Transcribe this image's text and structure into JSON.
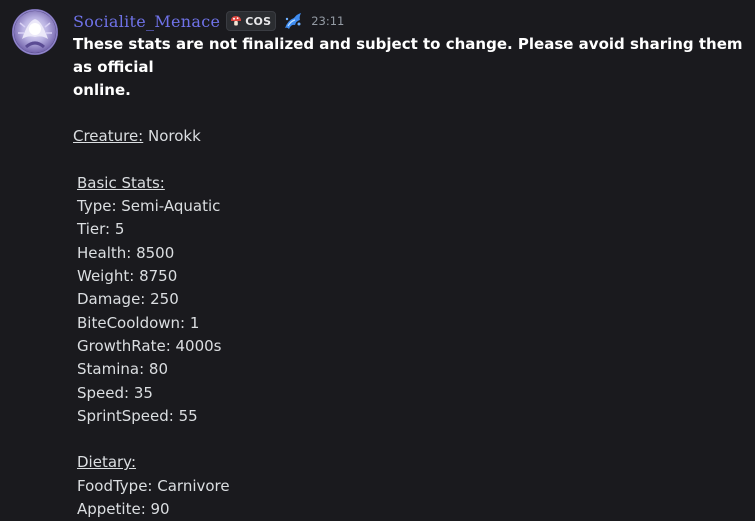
{
  "message": {
    "username": "Socialite_Menace",
    "tag": {
      "text": "COS",
      "icon": "mushroom-icon"
    },
    "role_icon": "blue-splash-icon",
    "timestamp": "23:11",
    "warning_line1": "These stats are not finalized and subject to change. Please avoid sharing them as official",
    "warning_line2": "online.",
    "creature_label": "Creature:",
    "creature_value": " Norokk",
    "basic_stats_heading": "Basic Stats:",
    "stats": [
      "Type: Semi-Aquatic",
      "Tier: 5",
      "Health: 8500",
      "Weight: 8750",
      "Damage: 250",
      "BiteCooldown: 1",
      "GrowthRate: 4000s",
      "Stamina: 80",
      "Speed: 35",
      "SprintSpeed: 55"
    ],
    "dietary_heading": "Dietary:",
    "dietary": [
      "FoodType: Carnivore",
      "Appetite: 90"
    ]
  },
  "colors": {
    "background": "#1a1a1e",
    "username": "#6f72e8",
    "text": "#dbdee1",
    "timestamp": "#949ba4"
  }
}
